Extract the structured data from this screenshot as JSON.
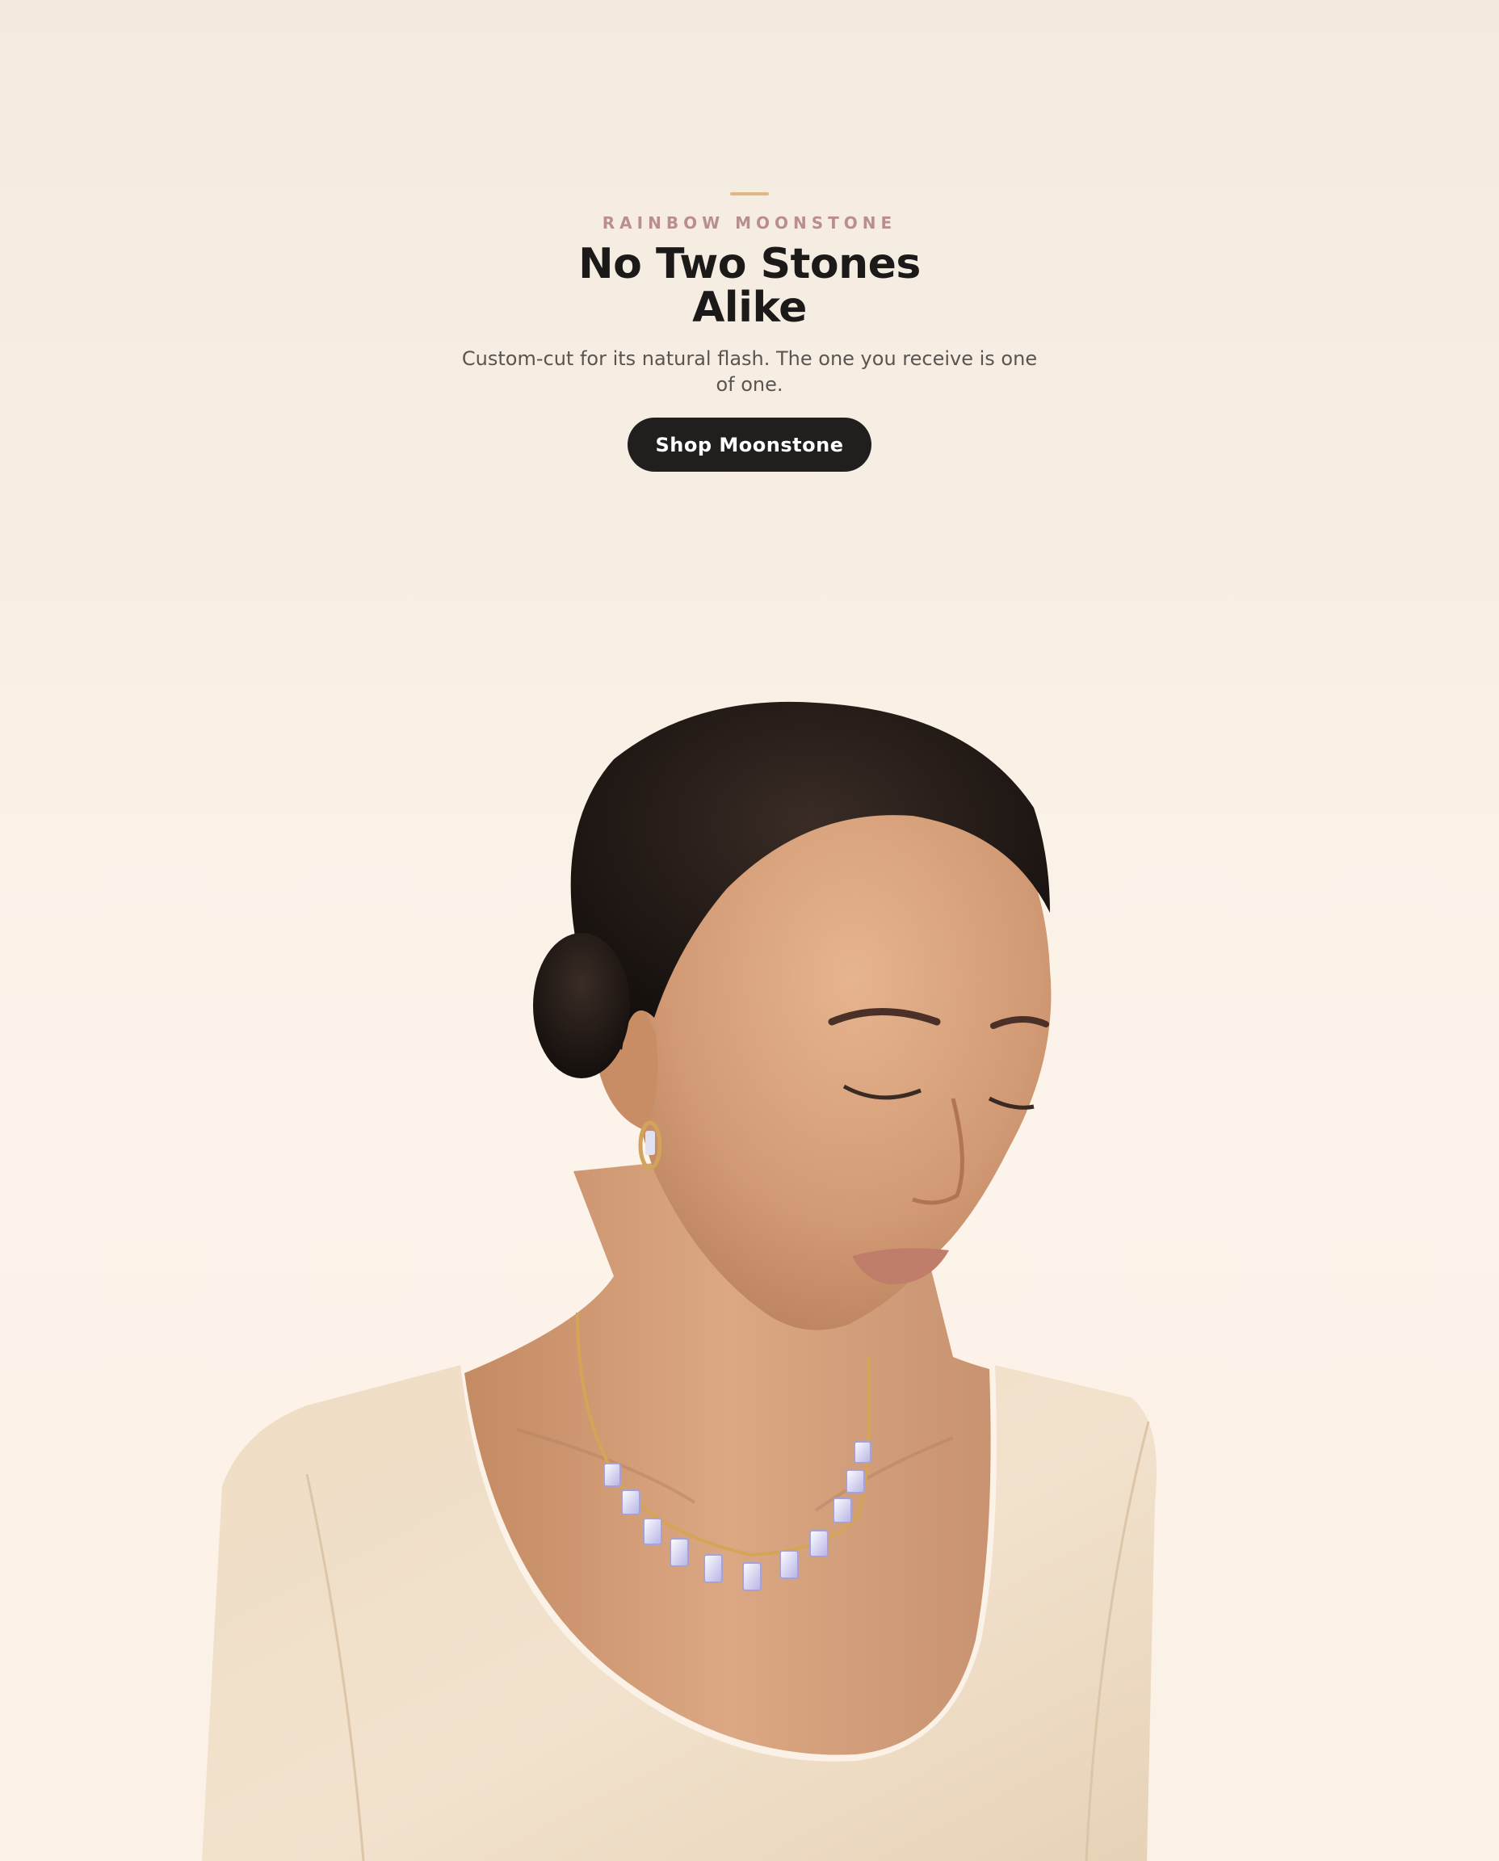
{
  "hero": {
    "eyebrow": "RAINBOW MOONSTONE",
    "headline_line1": "No Two Stones",
    "headline_line2": "Alike",
    "subcopy": "Custom-cut for its natural flash. The one you receive is one of one.",
    "cta_label": "Shop Moonstone"
  },
  "colors": {
    "background": "#f6ede2",
    "accent_rule": "#e2b97c",
    "eyebrow": "#b98f8d",
    "headline": "#1c1a19",
    "subcopy": "#5b5450",
    "cta_background": "#211f1e",
    "cta_text": "#ffffff"
  }
}
